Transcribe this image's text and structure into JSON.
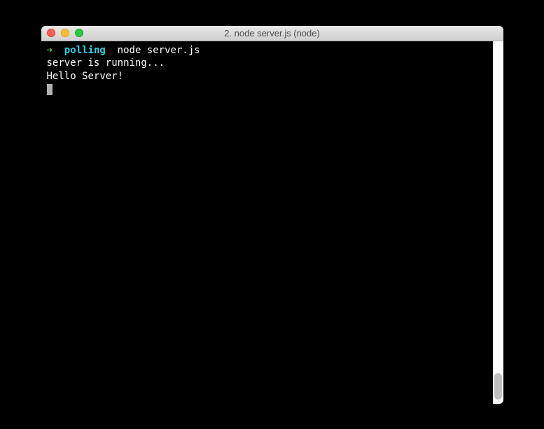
{
  "window": {
    "title": "2. node server.js (node)"
  },
  "prompt": {
    "arrow": "➜",
    "cwd": "polling",
    "command": "node server.js"
  },
  "output": [
    "server is running...",
    "Hello Server!"
  ]
}
